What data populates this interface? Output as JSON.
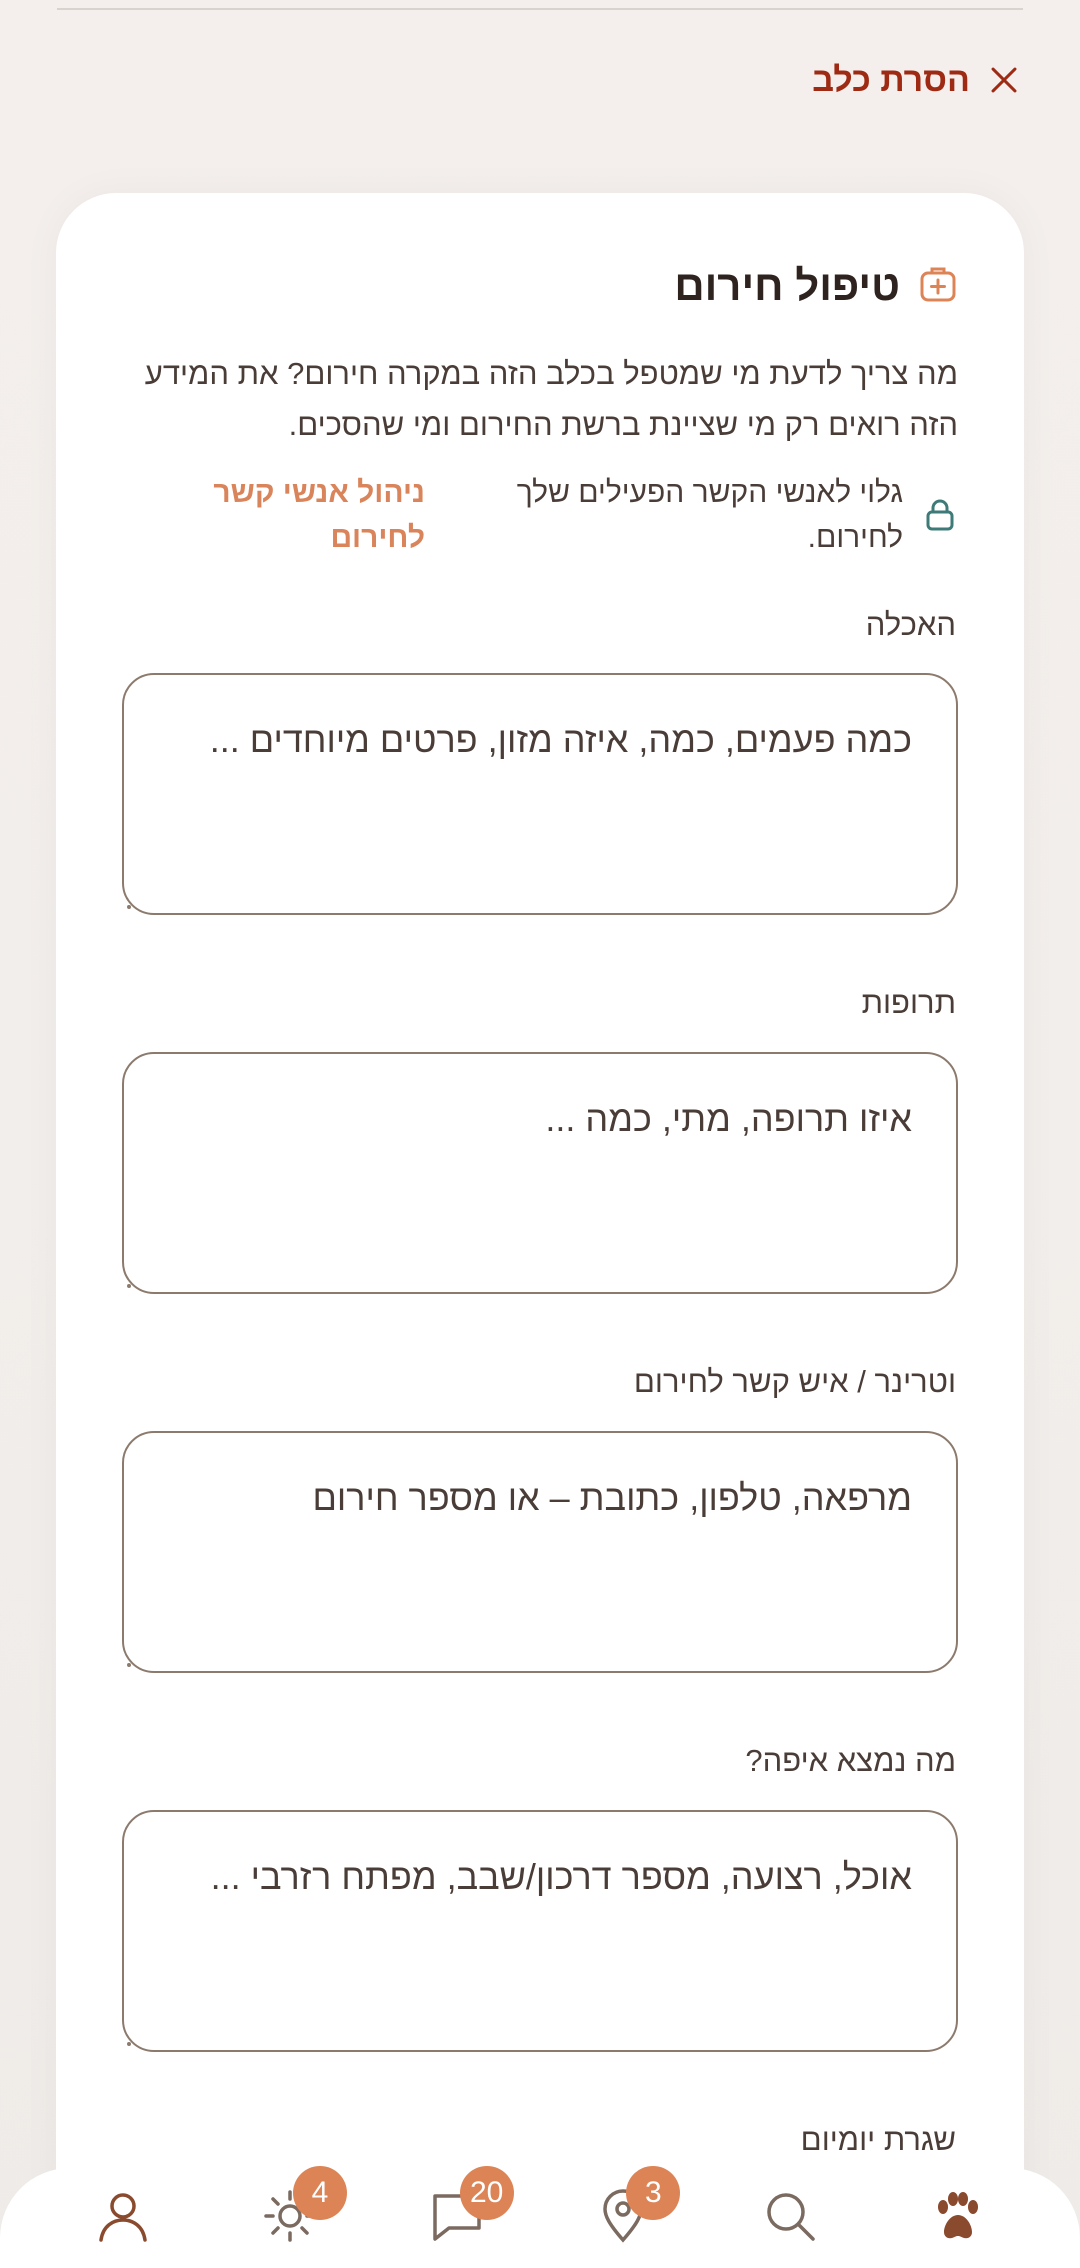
{
  "remove_dog": {
    "label": "הסרת כלב"
  },
  "section": {
    "title": "טיפול חירום",
    "icon": "first-aid-kit-icon"
  },
  "description": "מה צריך לדעת מי שמטפל בכלב הזה במקרה חירום? את המידע הזה רואים רק מי שציינת ברשת החירום ומי שהסכים.",
  "privacy": {
    "text": "גלוי לאנשי הקשר הפעילים שלך לחירום.",
    "link": "ניהול אנשי קשר לחירום",
    "icon": "lock-icon"
  },
  "fields": [
    {
      "label": "האכלה",
      "placeholder": "כמה פעמים, כמה, איזה מזון, פרטים מיוחדים ..."
    },
    {
      "label": "תרופות",
      "placeholder": "איזו תרופה, מתי, כמה ..."
    },
    {
      "label": "וטרינר / איש קשר לחירום",
      "placeholder": "מרפאה, טלפון, כתובת – או מספר חירום"
    },
    {
      "label": "מה נמצא איפה?",
      "placeholder": "אוכל, רצועה, מספר דרכון/שבב, מפתח רזרבי ..."
    },
    {
      "label": "שגרת יומיום"
    }
  ],
  "nav": {
    "items": [
      {
        "icon": "profile-icon"
      },
      {
        "icon": "sun-icon",
        "badge": "4"
      },
      {
        "icon": "chat-icon",
        "badge": "20"
      },
      {
        "icon": "location-pin-icon",
        "badge": "3"
      },
      {
        "icon": "search-icon"
      },
      {
        "icon": "paw-icon"
      }
    ]
  },
  "colors": {
    "accent": "#dd8457",
    "danger": "#9e2a14",
    "border": "#8c7a6d",
    "icon": "#8a4a2e"
  }
}
